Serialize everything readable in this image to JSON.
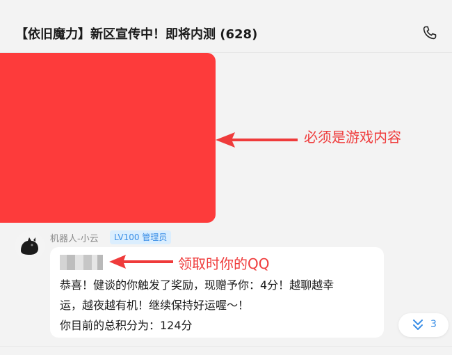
{
  "header": {
    "title": "【依旧魔力】新区宣传中！即将内测 (628)",
    "phone_icon": "phone-icon"
  },
  "annotations": {
    "game_content": "必须是游戏内容",
    "qq_hint": "领取时你的QQ",
    "color": "#ef3b3b"
  },
  "message": {
    "sender": "机器人-小云",
    "badge": "LV100 管理员",
    "avatar_icon": "black-cat-avatar",
    "lines": [
      "恭喜！健谈的你触发了奖励，现赠予你：4分！越聊越幸",
      "运，越夜越有机！继续保持好运喔～！",
      "你目前的总积分为：124分"
    ]
  },
  "scroll_button": {
    "count": "3",
    "icon": "double-chevron-down-icon"
  },
  "colors": {
    "redacted_block": "#fd3b3b",
    "accent": "#3a8ee6",
    "badge_bg": "#dbeefe",
    "background": "#f3f3f3"
  }
}
